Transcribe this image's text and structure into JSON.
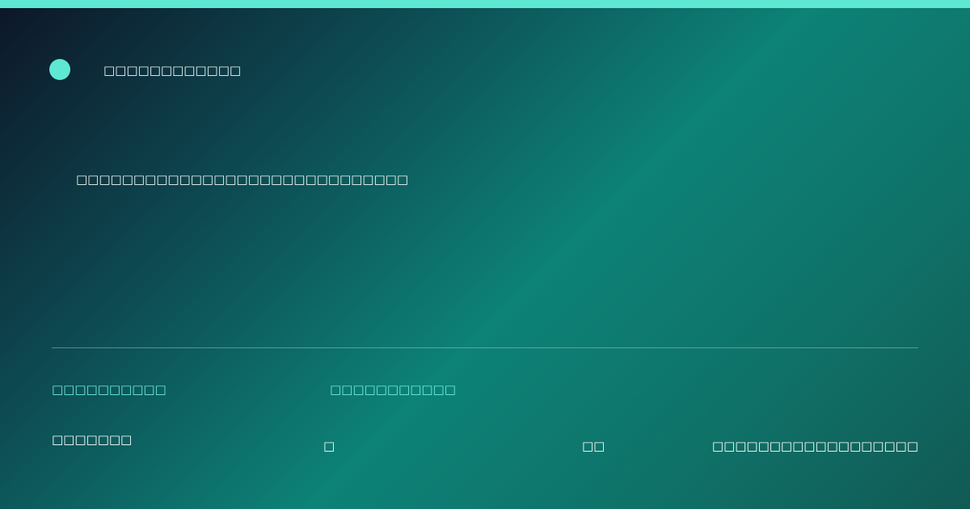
{
  "brand": {
    "name": "□□□□□□□□□□□□"
  },
  "hero": {
    "headline": "□□□□□□□□□□□□□□□□□□□□□□□□□□□□□"
  },
  "footer": {
    "labels": [
      "□□□□□□□□□□",
      "□□□□□□□□□□□"
    ],
    "meta": [
      "□□□□□□□",
      "□",
      "□□",
      "□□□□□□□□□□□□□□□□□□"
    ]
  },
  "colors": {
    "accent": "#5ee8d4",
    "background_start": "#0d1628",
    "background_mid": "#0d8277",
    "background_end": "#115a54"
  }
}
